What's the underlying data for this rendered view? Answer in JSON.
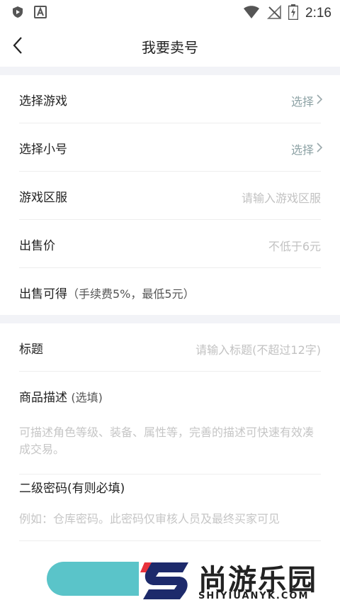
{
  "status_bar": {
    "time": "2:16",
    "icons": [
      "play-shield-icon",
      "a-icon",
      "wifi-icon",
      "signal-off-icon",
      "battery-charging-icon"
    ]
  },
  "nav": {
    "title": "我要卖号",
    "back_icon": "chevron-left-icon"
  },
  "form": {
    "game": {
      "label": "选择游戏",
      "action": "选择"
    },
    "account": {
      "label": "选择小号",
      "action": "选择"
    },
    "server": {
      "label": "游戏区服",
      "placeholder": "请输入游戏区服"
    },
    "price": {
      "label": "出售价",
      "placeholder": "不低于6元"
    },
    "earnings": {
      "label": "出售可得",
      "note": "（手续费5%，最低5元）"
    },
    "title": {
      "label": "标题",
      "placeholder": "请输入标题(不超过12字)"
    },
    "description": {
      "label": "商品描述",
      "optional": "(选填)",
      "placeholder": "可描述角色等级、装备、属性等，完善的描述可快速有效凑成交易。"
    },
    "password": {
      "label": "二级密码(有则必填)",
      "placeholder": "例如：仓库密码。此密码仅审核人员及最终买家可见"
    }
  },
  "watermark": {
    "cn": "尚游乐园",
    "en": "SHIYIUANYK.COM"
  },
  "colors": {
    "accent": "#5ac4c9",
    "brand_red": "#e8323c",
    "brand_navy": "#1d2a6b"
  }
}
